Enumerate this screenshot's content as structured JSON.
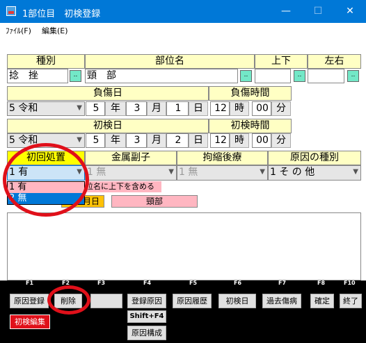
{
  "window": {
    "title": "1部位目　初検登録",
    "minimize": "—",
    "maximize": "☐",
    "close": "✕"
  },
  "menu": {
    "file": "ﾌｧｲﾙ(F)",
    "edit": "編集(E)"
  },
  "headers": {
    "kind": "種別",
    "part_name": "部位名",
    "updown": "上下",
    "leftright": "左右",
    "injury_date": "負傷日",
    "injury_time": "負傷時間",
    "first_date": "初検日",
    "first_time": "初検時間",
    "first_treatment": "初回処置",
    "metal": "金属副子",
    "contracture": "拘縮後療",
    "cause_kind": "原因の種別"
  },
  "fields": {
    "kind_value": "捻　挫",
    "part_value": "頸　部",
    "tealbtn": ".."
  },
  "injury": {
    "era": "5 令和",
    "year": "5",
    "year_lbl": "年",
    "month": "3",
    "month_lbl": "月",
    "day": "1",
    "day_lbl": "日",
    "hour": "12",
    "hour_lbl": "時",
    "min": "00",
    "min_lbl": "分"
  },
  "first": {
    "era": "5 令和",
    "year": "5",
    "year_lbl": "年",
    "month": "3",
    "month_lbl": "月",
    "day": "2",
    "day_lbl": "日",
    "hour": "12",
    "hour_lbl": "時",
    "min": "00",
    "min_lbl": "分"
  },
  "combos": {
    "first_treatment": "1 有",
    "metal": "1 無",
    "contracture": "1 無",
    "cause": "1 そ の 他"
  },
  "dropdown": {
    "item1": "1 有",
    "item2": "2 無"
  },
  "overlay": {
    "include_updown": "位名に上下を含める",
    "date_lbl": "月日",
    "part_lbl": "頸部"
  },
  "fkeys": [
    "F1",
    "F2",
    "F3",
    "F4",
    "F5",
    "F6",
    "F7",
    "F8",
    "F10"
  ],
  "buttons": {
    "cause_reg": "原因登録",
    "delete": "削除",
    "blank": "",
    "reg_cause": "登録原因",
    "shift_f4": "Shift+F4",
    "cause_comp": "原因構成",
    "cause_hist": "原因履歴",
    "first_date": "初検日",
    "past_injury": "過去傷病",
    "confirm": "確定",
    "end": "終了",
    "first_edit": "初検編集"
  },
  "colors": {
    "title_bar": "#0078d7",
    "header_bg": "#ffffc4",
    "teal": "#73e8c7",
    "pink": "#ffb6c1",
    "highlight_red": "#e0101a"
  }
}
